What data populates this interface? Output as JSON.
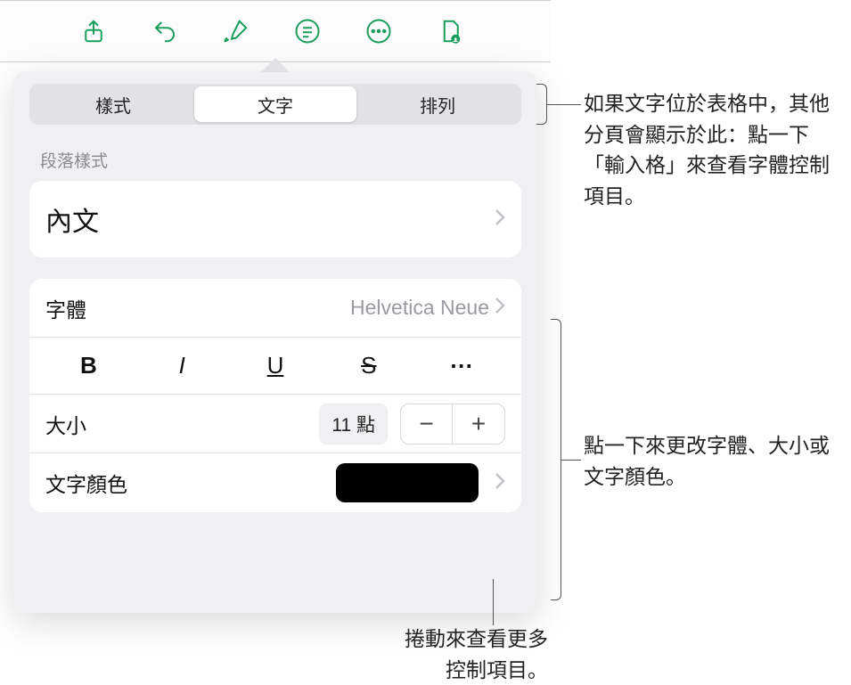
{
  "toolbar": {
    "icons": [
      "share-icon",
      "undo-icon",
      "format-brush-icon",
      "list-icon",
      "more-icon",
      "document-icon"
    ]
  },
  "tabs": {
    "style": "樣式",
    "text": "文字",
    "arrange": "排列"
  },
  "sections": {
    "paragraph_style_header": "段落樣式",
    "paragraph_style_value": "內文",
    "font_label": "字體",
    "font_value": "Helvetica Neue",
    "size_label": "大小",
    "size_value": "11 點",
    "color_label": "文字顏色",
    "color_value": "#000000",
    "style_buttons": {
      "bold": "B",
      "italic": "I",
      "underline": "U",
      "strike": "S",
      "more": "⋯"
    },
    "stepper": {
      "minus": "−",
      "plus": "+"
    }
  },
  "callouts": {
    "tabs_note": "如果文字位於表格中，其他分頁會顯示於此：點一下「輸入格」來查看字體控制項目。",
    "font_note": "點一下來更改字體、大小或文字顏色。",
    "scroll_note": "捲動來查看更多\n控制項目。"
  }
}
